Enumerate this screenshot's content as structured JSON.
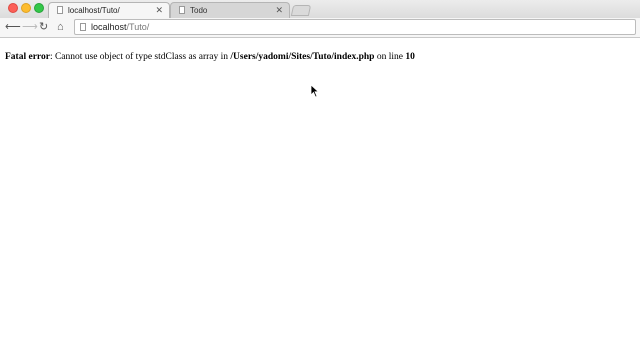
{
  "browser": {
    "tabs": [
      {
        "title": "localhost/Tuto/",
        "active": true
      },
      {
        "title": "Todo",
        "active": false
      }
    ],
    "url_host": "localhost",
    "url_path": "/Tuto/"
  },
  "page": {
    "error_label": "Fatal error",
    "sep": ": ",
    "message": "Cannot use object of type stdClass as array in ",
    "file": "/Users/yadomi/Sites/Tuto/index.php",
    "on_line": " on line ",
    "line": "10"
  },
  "colors": {
    "close": "#fc5f57",
    "minimize": "#fdbc2e",
    "maximize": "#33c748"
  },
  "icons": {
    "back": "back-arrow-icon",
    "forward": "forward-arrow-icon",
    "reload": "reload-icon",
    "home": "home-icon",
    "tab_close": "close-icon"
  }
}
